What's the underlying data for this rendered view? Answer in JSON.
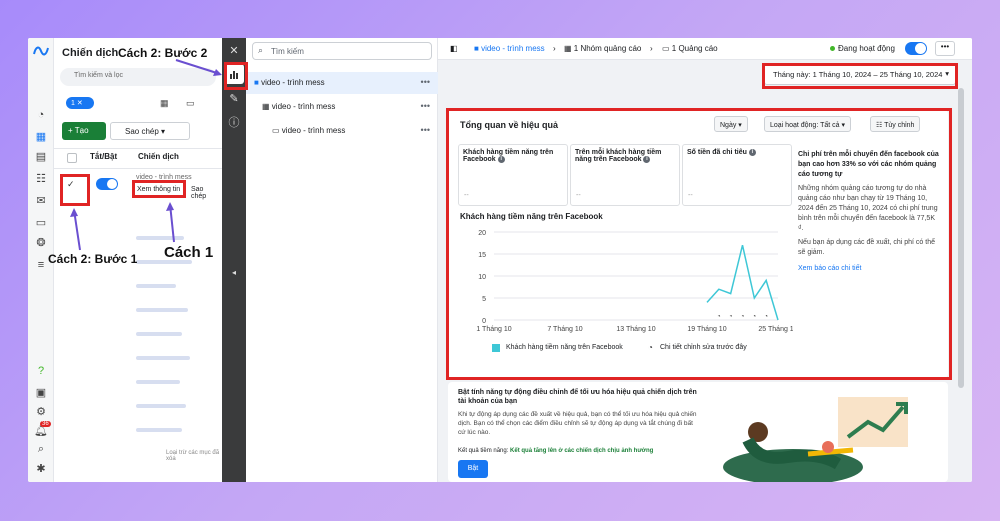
{
  "colors": {
    "accent": "#1877f2",
    "annotation_red": "#e02424",
    "create_green": "#1a7f37",
    "chart_line": "#3ec7d6"
  },
  "campaigns_panel": {
    "title": "Chiến dịch",
    "search_placeholder": "Tìm kiếm và lọc",
    "filter_count": "1",
    "create_label": "Tạo",
    "copy_label": "Sao chép",
    "col_toggle": "Tắt/Bật",
    "col_campaign": "Chiến dịch",
    "campaign_name": "video - trình mess",
    "view_btn": "Xem thông tin",
    "copy_btn": "Sao chép",
    "footer_text": "Loại trừ các mục đã xóa"
  },
  "tree": {
    "search_placeholder": "Tìm kiếm",
    "items": [
      {
        "label": "video - trình mess"
      },
      {
        "label": "video - trình mess"
      },
      {
        "label": "video - trình mess"
      }
    ]
  },
  "topbar": {
    "crumb1": "video - trình mess",
    "crumb2": "1 Nhóm quảng cáo",
    "crumb3": "1 Quảng cáo",
    "status": "Đang hoạt động"
  },
  "date_range": "Tháng này: 1 Tháng 10, 2024 – 25 Tháng 10, 2024",
  "overview": {
    "title": "Tổng quan về hiệu quả",
    "day_dropdown": "Ngày",
    "activity_dropdown": "Loại hoạt động: Tất cả",
    "customize": "Tùy chỉnh",
    "metric1": "Khách hàng tiềm năng trên Facebook",
    "metric2": "Trên mỗi khách hàng tiềm năng trên Facebook",
    "metric3": "Số tiền đã chi tiêu",
    "metric_value": "--",
    "chart_title": "Khách hàng tiềm năng trên Facebook",
    "legend1": "Khách hàng tiềm năng trên Facebook",
    "legend2": "Chi tiết chỉnh sửa trước đây",
    "side_heading": "Chi phí trên mỗi chuyển đến facebook của bạn cao hơn 33% so với các nhóm quảng cáo tương tự",
    "side_body": "Những nhóm quảng cáo tương tự do nhà quảng cáo như bạn chạy từ 19 Tháng 10, 2024 đến 25 Tháng 10, 2024 có chi phí trung bình trên mỗi chuyển đến facebook là 77,5K ₫.",
    "side_body2": "Nếu bạn áp dụng các đề xuất, chi phí có thể sẽ giảm.",
    "side_link": "Xem báo cáo chi tiết"
  },
  "auto": {
    "title": "Bật tính năng tự động điều chỉnh để tối ưu hóa hiệu quả chiến dịch trên tài khoản của bạn",
    "body": "Khi tự động áp dụng các đề xuất về hiệu quả, bạn có thể tối ưu hóa hiệu quả chiến dịch. Bạn có thể chọn các điểm điều chỉnh sẽ tự động áp dụng và tắt chúng đi bất cứ lúc nào.",
    "result_prefix": "Kết quả tiềm năng:",
    "result": "Kết quả tăng lên ở các chiến dịch chịu ảnh hưởng",
    "button": "Bật"
  },
  "annotations": {
    "step2_b2": "Cách 2: Bước 2",
    "step2_b1": "Cách 2: Bước 1",
    "way1": "Cách 1"
  },
  "badge_count": "36",
  "chart_data": {
    "type": "line",
    "title": "Khách hàng tiềm năng trên Facebook",
    "x_ticks": [
      "1 Tháng 10",
      "7 Tháng 10",
      "13 Tháng 10",
      "19 Tháng 10",
      "25 Tháng 10"
    ],
    "y_ticks": [
      0,
      5,
      10,
      15,
      20
    ],
    "ylim": [
      0,
      20
    ],
    "series": [
      {
        "name": "Khách hàng tiềm năng trên Facebook",
        "x": [
          19,
          20,
          21,
          22,
          23,
          24,
          25
        ],
        "y": [
          4,
          7,
          6,
          17,
          5,
          9,
          0
        ]
      }
    ]
  }
}
